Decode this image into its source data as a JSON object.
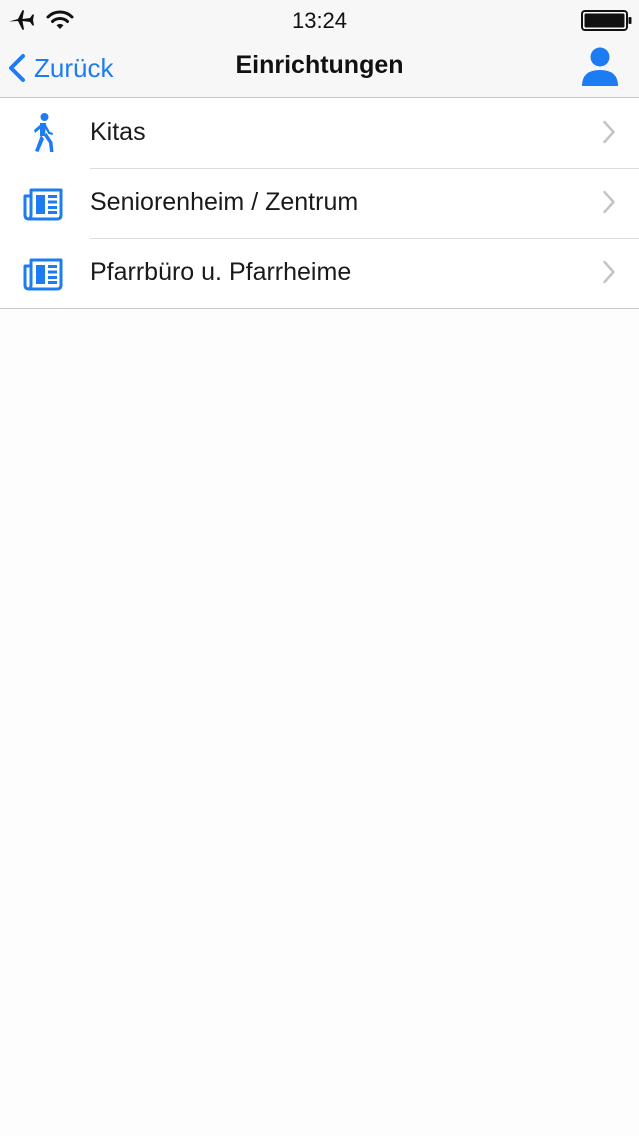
{
  "status_bar": {
    "time": "13:24",
    "icons": [
      "airplane-icon",
      "wifi-icon",
      "battery-icon"
    ]
  },
  "nav": {
    "back_label": "Zurück",
    "title": "Einrichtungen",
    "right_icon": "person-icon"
  },
  "list": {
    "items": [
      {
        "label": "Kitas",
        "icon": "walking-person-icon"
      },
      {
        "label": "Seniorenheim / Zentrum",
        "icon": "newspaper-icon"
      },
      {
        "label": "Pfarrbüro u. Pfarrheime",
        "icon": "newspaper-icon"
      }
    ]
  },
  "colors": {
    "accent": "#1d7cf2",
    "nav_background": "#f7f7f8",
    "separator": "#c8c8cc",
    "chevron": "#c4c4c8"
  }
}
